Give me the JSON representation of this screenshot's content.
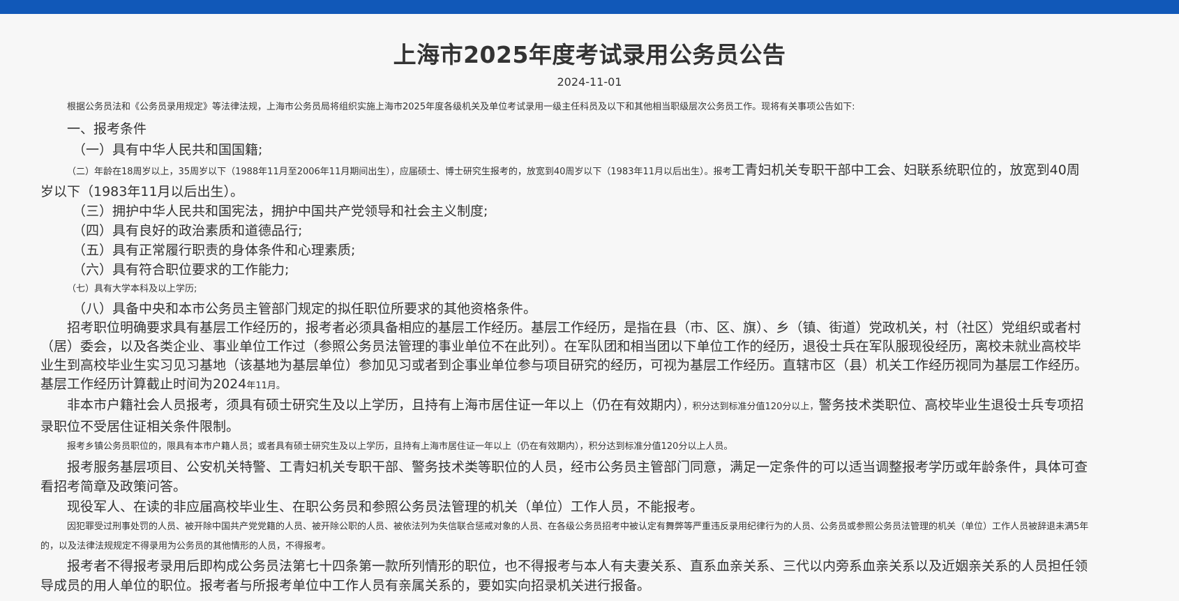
{
  "header": {
    "bar_color": "#1158b8"
  },
  "article": {
    "title": "上海市2025年度考试录用公务员公告",
    "date": "2024-11-01",
    "intro": "根据公务员法和《公务员录用规定》等法律法规，上海市公务员局将组织实施上海市2025年度各级机关及单位考试录用一级主任科员及以下和其他相当职级层次公务员工作。现将有关事项公告如下:",
    "section1_heading": "一、报考条件",
    "cond1": "（一）具有中华人民共和国国籍;",
    "cond2_small": "（二）年龄在18周岁以上，35周岁以下（1988年11月至2006年11月期间出生），应届硕士、博士研究生报考的，放宽到40周岁以下（1983年11月以后出生）。报考",
    "cond2_big": "工青妇机关专职干部中工会、妇联系统职位的，放宽到40周岁以下（1983年11月以后出生）。",
    "cond3": "（三）拥护中华人民共和国宪法，拥护中国共产党领导和社会主义制度;",
    "cond4": "（四）具有良好的政治素质和道德品行;",
    "cond5": "（五）具有正常履行职责的身体条件和心理素质;",
    "cond6": "（六）具有符合职位要求的工作能力;",
    "cond7": "（七）具有大学本科及以上学历;",
    "cond8": "（八）具备中央和本市公务员主管部门规定的拟任职位所要求的其他资格条件。",
    "grassroots_big": "招考职位明确要求具有基层工作经历的，报考者必须具备相应的基层工作经历。基层工作经历，是指在县（市、区、旗）、乡（镇、街道）党政机关，村（社区）党组织或者村（居）委会，以及各类企业、事业单位工作过（参照公务员法管理的事业单位不在此列）。在军队团和相当团以下单位工作的经历，退役士兵在军队服现役经历，离校未就业高校毕业生到高校毕业生实习见习基地（该基地为基层单位）参加见习或者到企事业单位参与项目研究的经历，可视为基层工作经历。直辖市区（县）机关工作经历视同为基层工作经历。基层工作经历计算截止时间为2024",
    "grassroots_small": "年11月。",
    "nonlocal_big1": "非本市户籍社会人员报考，须具有硕士研究生及以上学历，且持有上海市居住证一年以上（仍在有效期内）",
    "nonlocal_small": "，积分达到标准分值120分以上，",
    "nonlocal_big2": "警务技术类职位、高校毕业生退役士兵专项招录职位不受居住证相关条件限制。",
    "township": "报考乡镇公务员职位的，限具有本市户籍人员；或者具有硕士研究生及以上学历，且持有上海市居住证一年以上（仍在有效期内），积分达到标准分值120分以上人员。",
    "adjust": "报考服务基层项目、公安机关特警、工青妇机关专职干部、警务技术类等职位的人员，经市公务员主管部门同意，满足一定条件的可以适当调整报考学历或年龄条件，具体可查看招考简章及政策问答。",
    "excluded1": "现役军人、在读的非应届高校毕业生、在职公务员和参照公务员法管理的机关（单位）工作人员，不能报考。",
    "excluded2": "因犯罪受过刑事处罚的人员、被开除中国共产党党籍的人员、被开除公职的人员、被依法列为失信联合惩戒对象的人员、在各级公务员招考中被认定有舞弊等严重违反录用纪律行为的人员、公务员或参照公务员法管理的机关（单位）工作人员被辞退未满5年的，以及法律法规规定不得录用为公务员的其他情形的人员，不得报考。",
    "relation": "报考者不得报考录用后即构成公务员法第七十四条第一款所列情形的职位，也不得报考与本人有夫妻关系、直系血亲关系、三代以内旁系血亲关系以及近姻亲关系的人员担任领导成员的用人单位的职位。报考者与所报考单位中工作人员有亲属关系的，要如实向招录机关进行报备。"
  }
}
